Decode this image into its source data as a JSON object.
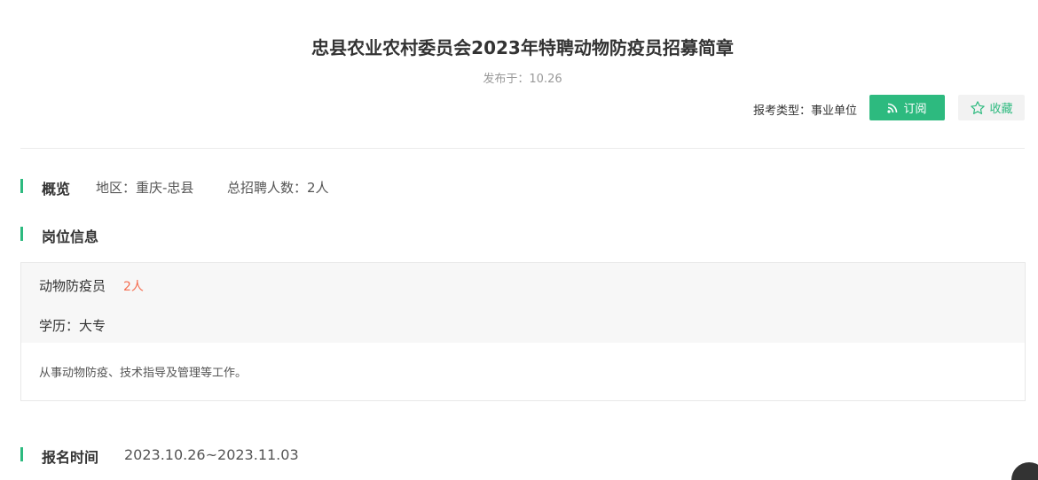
{
  "header": {
    "title": "忠县农业农村委员会2023年特聘动物防疫员招募简章",
    "pub_prefix": "发布于：",
    "pub_date": "10.26",
    "exam_type_label": "报考类型：",
    "exam_type_value": "事业单位",
    "subscribe_label": "订阅",
    "favorite_label": "收藏"
  },
  "overview": {
    "title": "概览",
    "region_label": "地区：",
    "region_value": "重庆-忠县",
    "total_label": "总招聘人数：",
    "total_value": "2人"
  },
  "positions": {
    "title": "岗位信息",
    "items": [
      {
        "name": "动物防疫员",
        "count": "2人",
        "education_label": "学历：",
        "education_value": "大专",
        "description": "从事动物防疫、技术指导及管理等工作。"
      }
    ]
  },
  "signup": {
    "title": "报名时间",
    "range": "2023.10.26~2023.11.03"
  },
  "colors": {
    "accent": "#2dba7f",
    "count_red": "#f56c4f",
    "muted": "#999999"
  },
  "icons": {
    "subscribe": "rss-icon",
    "favorite": "star-icon"
  }
}
